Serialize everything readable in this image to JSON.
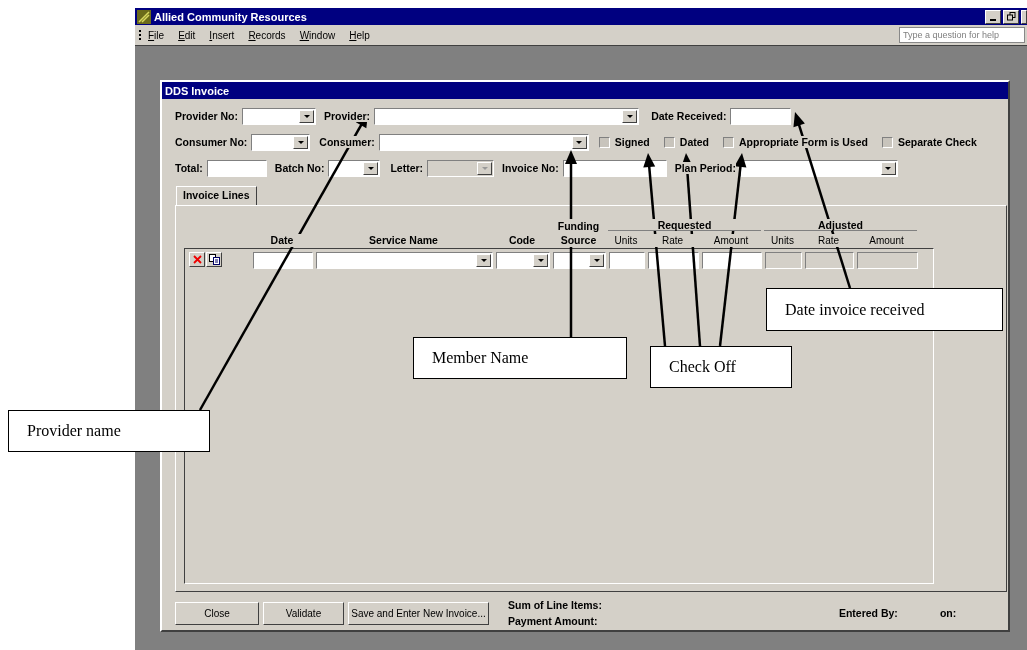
{
  "window": {
    "title": "Allied Community Resources"
  },
  "menu": [
    "File",
    "Edit",
    "Insert",
    "Records",
    "Window",
    "Help"
  ],
  "help_search": {
    "placeholder": "Type a question for help"
  },
  "form": {
    "title": "DDS Invoice",
    "rows": [
      {
        "fields": [
          {
            "kind": "combo",
            "label": "Provider No:",
            "disabled": false
          },
          {
            "kind": "combo",
            "label": "Provider:",
            "disabled": false
          },
          {
            "kind": "text",
            "label": "Date Received:",
            "disabled": false
          }
        ]
      },
      {
        "fields": [
          {
            "kind": "combo",
            "label": "Consumer No:",
            "disabled": false
          },
          {
            "kind": "combo",
            "label": "Consumer:",
            "disabled": false
          },
          {
            "kind": "checkbox",
            "label": "Signed",
            "checked": false
          },
          {
            "kind": "checkbox",
            "label": "Dated",
            "checked": false
          },
          {
            "kind": "checkbox",
            "label": "Appropriate Form is Used",
            "checked": false
          },
          {
            "kind": "checkbox",
            "label": "Separate Check",
            "checked": false
          }
        ]
      },
      {
        "fields": [
          {
            "kind": "text",
            "label": "Total:",
            "disabled": false
          },
          {
            "kind": "combo",
            "label": "Batch No:",
            "disabled": false
          },
          {
            "kind": "combo",
            "label": "Letter:",
            "disabled": true
          },
          {
            "kind": "text",
            "label": "Invoice No:",
            "disabled": false
          },
          {
            "kind": "combo",
            "label": "Plan Period:",
            "disabled": false
          }
        ]
      }
    ],
    "tabs": [
      {
        "label": "Invoice Lines",
        "selected": true
      }
    ],
    "groups": [
      {
        "label": "Requested"
      },
      {
        "label": "Adjusted"
      }
    ],
    "columns": [
      {
        "header": "Date",
        "kind": "text",
        "disabled": false
      },
      {
        "header": "Service Name",
        "kind": "combo",
        "disabled": false
      },
      {
        "header": "Code",
        "kind": "combo",
        "disabled": false
      },
      {
        "header": "Funding Source",
        "kind": "combo",
        "disabled": false
      },
      {
        "header": "Units",
        "kind": "text",
        "disabled": false
      },
      {
        "header": "Rate",
        "kind": "text",
        "disabled": false
      },
      {
        "header": "Amount",
        "kind": "text",
        "disabled": false
      },
      {
        "header": "Units",
        "kind": "text",
        "disabled": true
      },
      {
        "header": "Rate",
        "kind": "text",
        "disabled": true
      },
      {
        "header": "Amount",
        "kind": "text",
        "disabled": true
      }
    ],
    "buttons": [
      "Close",
      "Validate",
      "Save and Enter New Invoice..."
    ],
    "totals": [
      "Sum of Line Items:",
      "Payment Amount:"
    ],
    "entered_by": "Entered By:",
    "entered_on": "on:"
  },
  "annotations": [
    {
      "text": "Provider name"
    },
    {
      "text": "Member Name"
    },
    {
      "text": "Check Off"
    },
    {
      "text": "Date invoice received"
    }
  ]
}
